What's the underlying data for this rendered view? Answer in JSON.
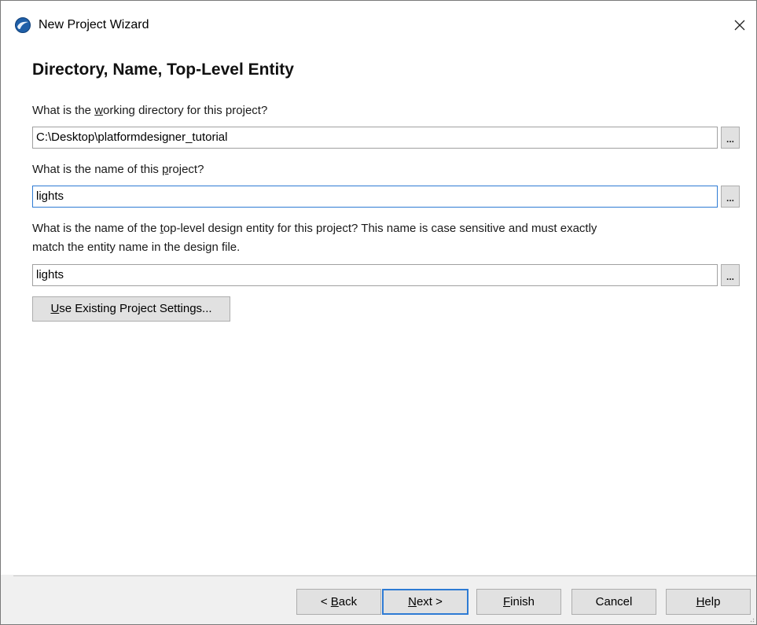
{
  "window": {
    "title": "New Project Wizard",
    "close_glyph": "✕"
  },
  "page": {
    "heading": "Directory, Name, Top-Level Entity"
  },
  "working_directory": {
    "label_pre": "What is the ",
    "label_u": "w",
    "label_post": "orking directory for this project?",
    "value": "C:\\Desktop\\platformdesigner_tutorial",
    "browse_label": "..."
  },
  "project_name": {
    "label_pre": "What is the name of this ",
    "label_u": "p",
    "label_post": "roject?",
    "value": "lights",
    "browse_label": "..."
  },
  "top_level": {
    "label_pre": "What is the name of the ",
    "label_u": "t",
    "label_post": "op-level design entity for this project? This name is case sensitive and must exactly",
    "label_line2": "match the entity name in the design file.",
    "value": "lights",
    "browse_label": "..."
  },
  "existing_settings": {
    "label_u": "U",
    "label_post": "se Existing Project Settings..."
  },
  "footer": {
    "back": {
      "pre": "< ",
      "u": "B",
      "post": "ack"
    },
    "next": {
      "u": "N",
      "post": "ext >"
    },
    "finish": {
      "u": "F",
      "post": "inish"
    },
    "cancel": {
      "label": "Cancel"
    },
    "help": {
      "u": "H",
      "post": "elp"
    }
  },
  "icons": {
    "app": "quartus-globe-icon",
    "close": "close-icon"
  },
  "colors": {
    "focus_border": "#2e7bd4",
    "dialog_bg": "#f0f0f0"
  }
}
